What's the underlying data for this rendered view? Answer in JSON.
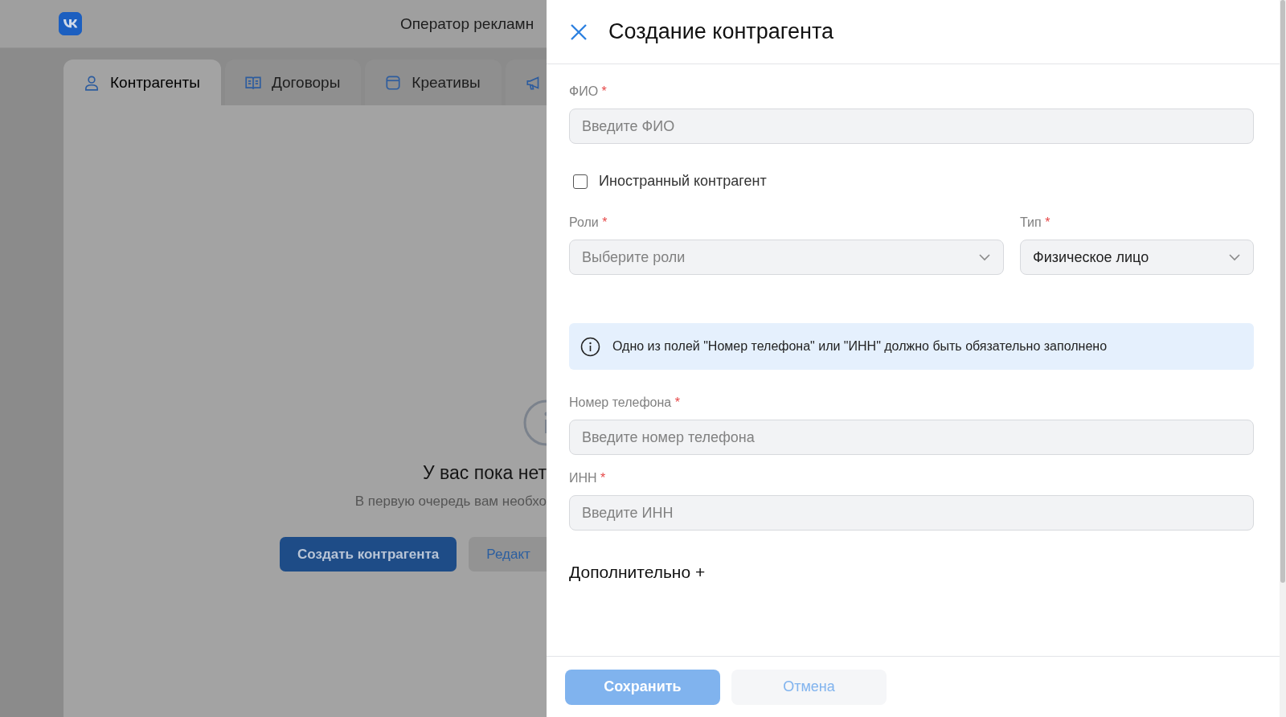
{
  "header": {
    "title": "Оператор рекламн"
  },
  "tabs": [
    {
      "label": "Контрагенты",
      "selected": true
    },
    {
      "label": "Договоры",
      "selected": false
    },
    {
      "label": "Креативы",
      "selected": false
    },
    {
      "selected": false
    }
  ],
  "empty_state": {
    "title": "У вас пока нет",
    "subtitle": "В первую очередь вам необхо",
    "buttons": [
      {
        "label": "Создать контрагента",
        "kind": "primary"
      },
      {
        "label": "Редакт",
        "kind": "secondary"
      }
    ]
  },
  "drawer": {
    "title": "Создание контрагента",
    "fields": [
      {
        "kind": "input",
        "label": "ФИО",
        "required_mark": "*",
        "placeholder": "Введите ФИО"
      },
      {
        "kind": "checkbox",
        "label": "Иностранный контрагент",
        "checked": false
      },
      {
        "kind": "selects",
        "items": [
          {
            "label": "Роли",
            "required_mark": "*",
            "placeholder": "Выберите роли"
          },
          {
            "label": "Тип",
            "required_mark": "*",
            "value": "Физическое лицо"
          }
        ]
      },
      {
        "kind": "info",
        "text": "Одно из полей \"Номер телефона\" или \"ИНН\" должно быть обязательно заполнено"
      },
      {
        "kind": "input",
        "label": "Номер телефона",
        "required_mark": "*",
        "placeholder": "Введите номер телефона"
      },
      {
        "kind": "input",
        "label": "ИНН",
        "required_mark": "*",
        "placeholder": "Введите ИНН"
      },
      {
        "kind": "expander",
        "label": "Дополнительно +"
      }
    ],
    "buttons": [
      {
        "label": "Сохранить",
        "kind": "primary",
        "disabled": true
      },
      {
        "label": "Отмена",
        "kind": "secondary",
        "disabled": true
      }
    ]
  }
}
